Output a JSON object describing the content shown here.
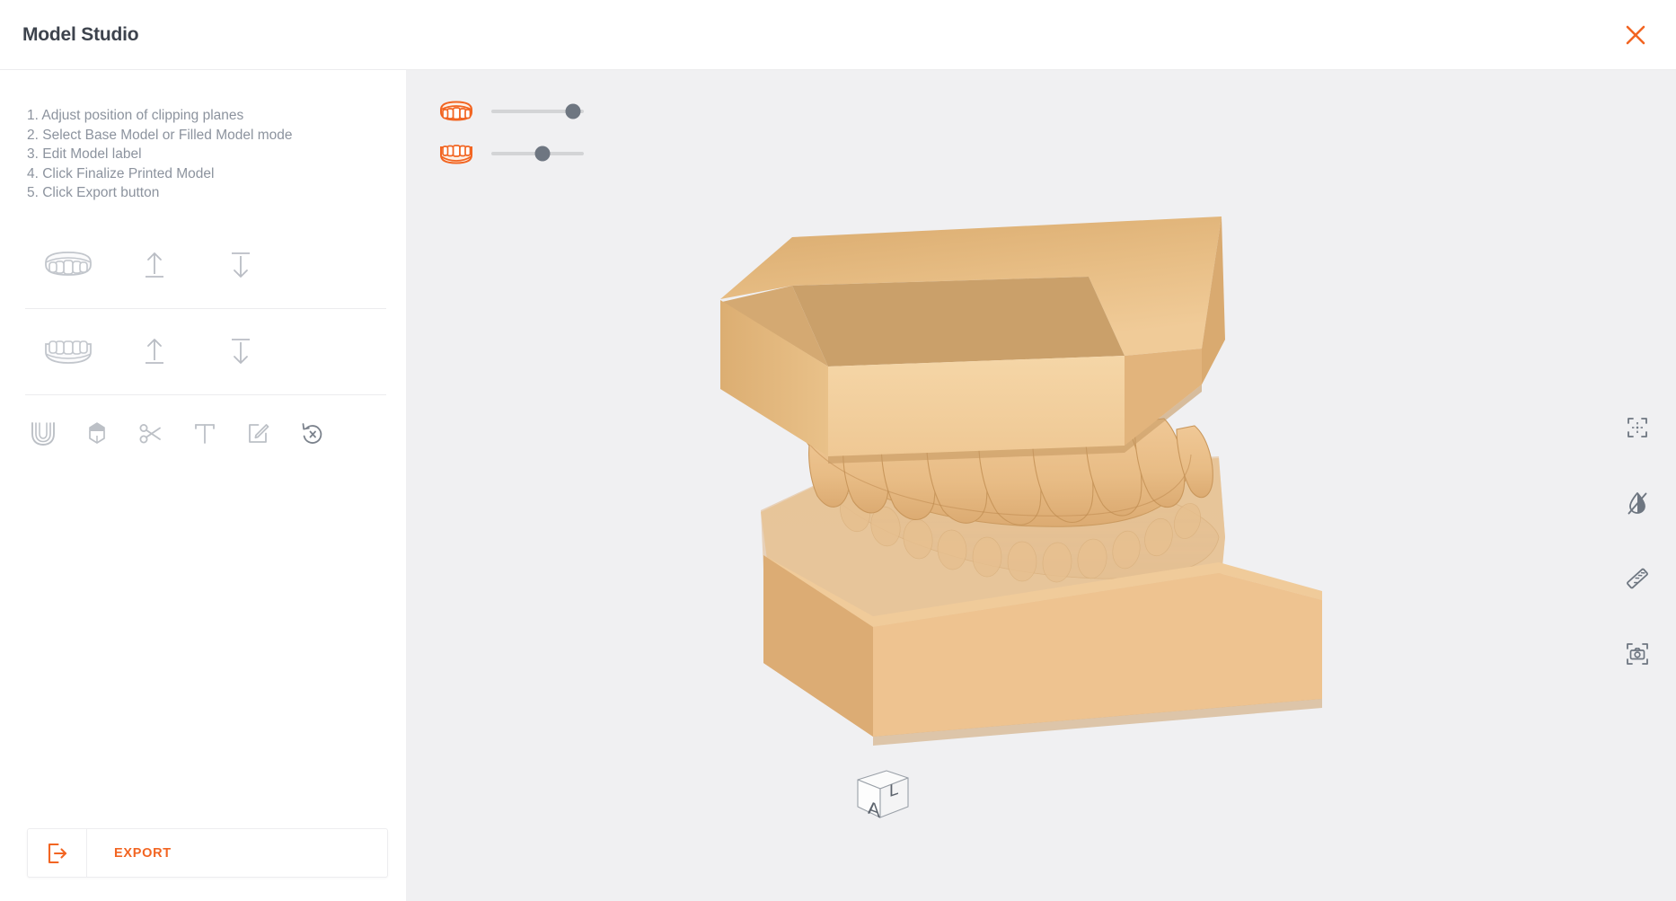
{
  "header": {
    "title": "Model Studio",
    "close_label": "×",
    "close_icon": "close-icon",
    "close_color": "#f26522"
  },
  "sidebar": {
    "instructions": [
      "1. Adjust position of clipping planes",
      "2. Select Base Model or Filled Model mode",
      "3. Edit Model label",
      "4. Click Finalize Printed Model",
      "5. Click Export button"
    ],
    "arch_rows": [
      {
        "arch_icon": "upper-arch-icon",
        "arch_label": "Upper Arch",
        "actions": [
          {
            "icon": "align-up-icon",
            "label": "Align Upper To Top"
          },
          {
            "icon": "align-down-icon",
            "label": "Align Upper To Bottom"
          }
        ]
      },
      {
        "arch_icon": "lower-arch-icon",
        "arch_label": "Lower Arch",
        "actions": [
          {
            "icon": "align-up-icon",
            "label": "Align Lower To Top"
          },
          {
            "icon": "align-down-icon",
            "label": "Align Lower To Bottom"
          }
        ]
      }
    ],
    "tools": [
      {
        "icon": "base-model-icon",
        "label": "Base Model"
      },
      {
        "icon": "filled-model-icon",
        "label": "Filled Model"
      },
      {
        "icon": "scissors-icon",
        "label": "Trim"
      },
      {
        "icon": "text-label-icon",
        "label": "Model Label"
      },
      {
        "icon": "edit-pencil-icon",
        "label": "Edit Label"
      },
      {
        "icon": "reset-icon",
        "label": "Reset"
      }
    ],
    "export": {
      "label": "EXPORT",
      "icon": "export-icon",
      "color": "#f26522"
    }
  },
  "viewport": {
    "background": "#f0f0f2",
    "sliders": [
      {
        "icon": "upper-arch-clip-icon",
        "label": "Upper clipping plane",
        "value": 88,
        "min": 0,
        "max": 100,
        "icon_color": "#f26522"
      },
      {
        "icon": "lower-arch-clip-icon",
        "label": "Lower clipping plane",
        "value": 55,
        "min": 0,
        "max": 100,
        "icon_color": "#f26522"
      }
    ],
    "right_tools": [
      {
        "icon": "fit-to-view-icon",
        "label": "Fit To View"
      },
      {
        "icon": "occlusion-off-icon",
        "label": "Toggle Occlusion"
      },
      {
        "icon": "ruler-icon",
        "label": "Measure"
      },
      {
        "icon": "screenshot-icon",
        "label": "Screenshot"
      }
    ],
    "view_cube": {
      "label": "View Orientation",
      "front_face": "A",
      "side_face": "L"
    },
    "model": {
      "label": "Dental Model Preview",
      "material_color": "#edc286",
      "shade_color": "#d7a968",
      "highlight_color": "#f3d3a4"
    }
  },
  "colors": {
    "accent": "#f26522",
    "text_primary": "#3d434d",
    "text_muted": "#8c939e",
    "icon_gray": "#bcc0c6",
    "divider": "#ececee"
  }
}
